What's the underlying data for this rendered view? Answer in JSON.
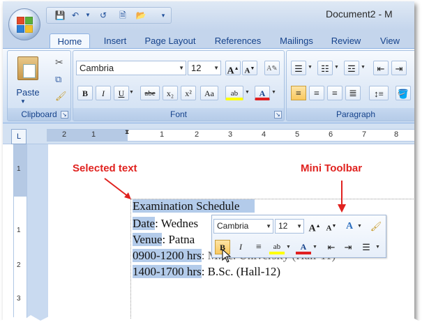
{
  "window": {
    "title": "Document2 - M"
  },
  "quick_access": {
    "icons": [
      "save-icon",
      "undo-icon",
      "redo-icon",
      "new-document-icon",
      "open-folder-icon",
      "customize-icon"
    ]
  },
  "tabs": [
    {
      "label": "Home",
      "active": true
    },
    {
      "label": "Insert"
    },
    {
      "label": "Page Layout"
    },
    {
      "label": "References"
    },
    {
      "label": "Mailings"
    },
    {
      "label": "Review"
    },
    {
      "label": "View"
    }
  ],
  "ribbon": {
    "clipboard": {
      "label": "Clipboard",
      "paste_label": "Paste"
    },
    "font": {
      "label": "Font",
      "font_name": "Cambria",
      "font_size": "12",
      "grow": "A",
      "shrink": "A",
      "bold": "B",
      "italic": "I",
      "underline": "U",
      "strike": "abe",
      "sub": "x₂",
      "sup": "x²",
      "change_case": "Aa",
      "highlight": "ab",
      "font_color": "A"
    },
    "paragraph": {
      "label": "Paragraph"
    }
  },
  "ruler": {
    "marks": [
      "2",
      "1",
      "1",
      "2",
      "3",
      "4",
      "5",
      "6",
      "7",
      "8"
    ],
    "tab_selector": "L",
    "vmarks": [
      "1",
      "1",
      "2",
      "3"
    ]
  },
  "document": {
    "lines": [
      {
        "a": "Examination Schedule",
        "b": ""
      },
      {
        "a": "Date",
        "b": ": Wednes"
      },
      {
        "a": "Venue",
        "b": ": Patna"
      },
      {
        "a": "0900-1200 hrs",
        "b": ": M.Sc. University (Hall-11)"
      },
      {
        "a": "1400-1700 hrs",
        "b": ": B.Sc. (Hall-12)"
      }
    ]
  },
  "mini_toolbar": {
    "font_name": "Cambria",
    "font_size": "12",
    "grow": "A",
    "shrink": "A",
    "styles": "A",
    "bold": "B",
    "italic": "I",
    "center": "≡",
    "highlight": "ab",
    "font_color": "A"
  },
  "callouts": {
    "selected_text": "Selected text",
    "mini_toolbar": "Mini Toolbar"
  },
  "colors": {
    "accent_red": "#e0221f",
    "highlight_yellow": "#ffff00",
    "font_red": "#e02020"
  }
}
